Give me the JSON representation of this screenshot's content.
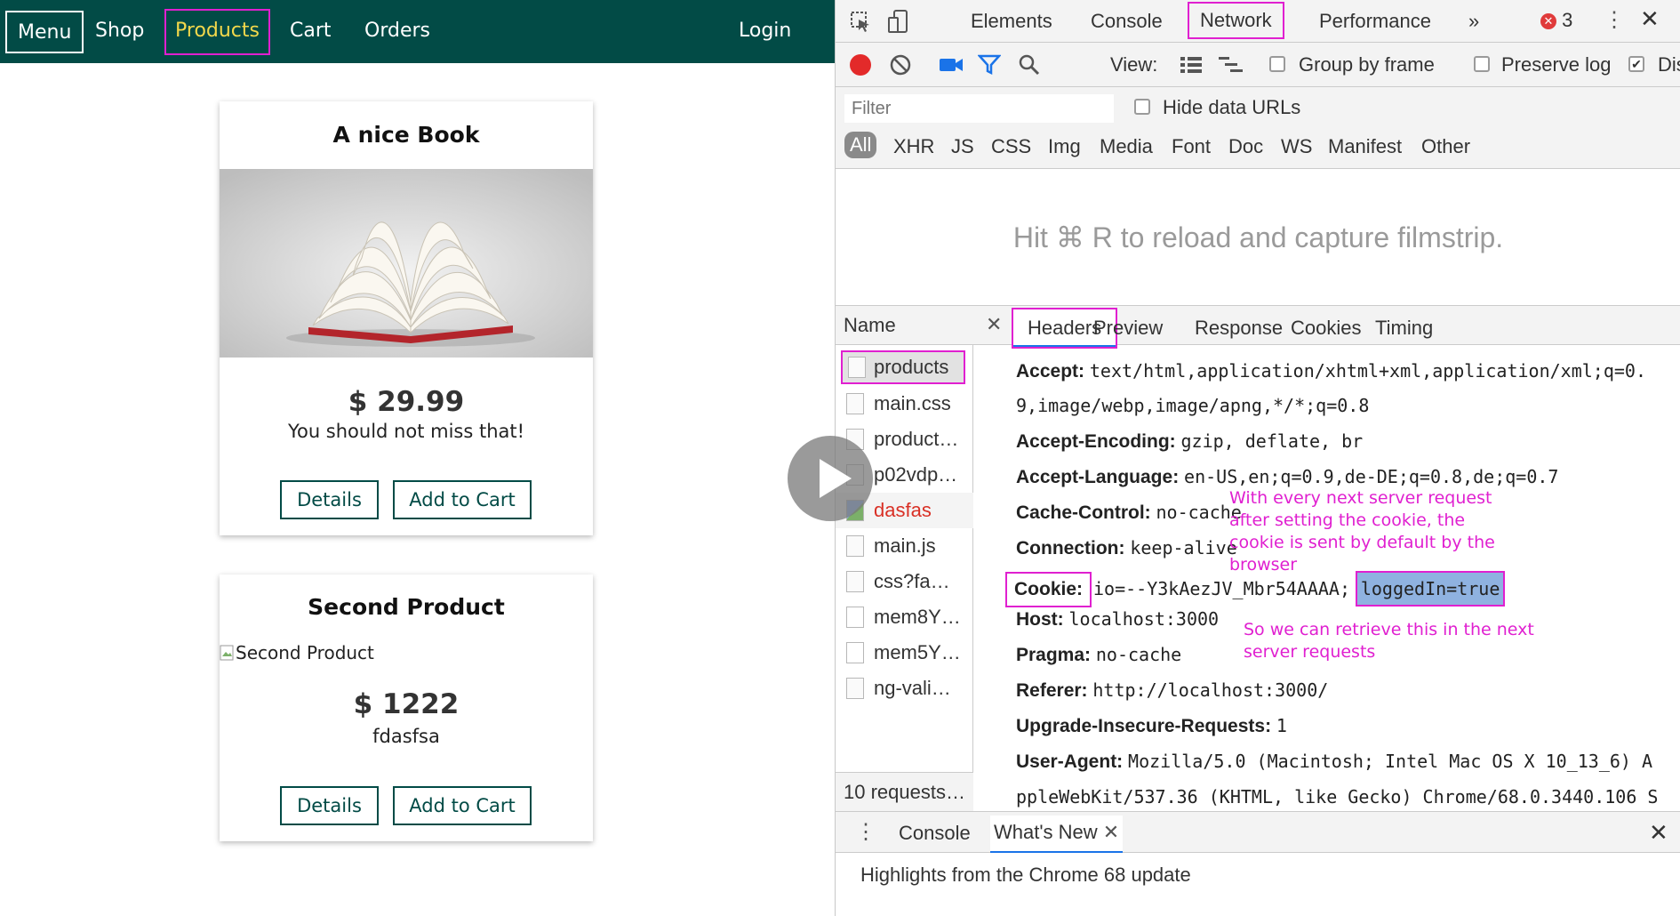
{
  "nav": {
    "menu": "Menu",
    "shop": "Shop",
    "products": "Products",
    "cart": "Cart",
    "orders": "Orders",
    "login": "Login"
  },
  "products": [
    {
      "title": "A nice Book",
      "price": "$ 29.99",
      "description": "You should not miss that!",
      "details_label": "Details",
      "add_label": "Add to Cart"
    },
    {
      "title": "Second Product",
      "image_alt": "Second Product",
      "price": "$ 1222",
      "description": "fdasfsa",
      "details_label": "Details",
      "add_label": "Add to Cart"
    }
  ],
  "devtools": {
    "tabs": [
      "Elements",
      "Console",
      "Network",
      "Performance",
      "»"
    ],
    "error_count": "3",
    "toolbar": {
      "view_label": "View:",
      "group_by_frame": "Group by frame",
      "preserve_log": "Preserve log",
      "disable_cache": "Dis"
    },
    "filter_placeholder": "Filter",
    "hide_data_urls": "Hide data URLs",
    "types": [
      "All",
      "XHR",
      "JS",
      "CSS",
      "Img",
      "Media",
      "Font",
      "Doc",
      "WS",
      "Manifest",
      "Other"
    ],
    "filmstrip_hint": "Hit ⌘ R to reload and capture filmstrip.",
    "name_header": "Name",
    "requests": [
      "products",
      "main.css",
      "product…",
      "p02vdp…",
      "dasfas",
      "main.js",
      "css?fa…",
      "mem8Y…",
      "mem5Y…",
      "ng-vali…"
    ],
    "request_count": "10 requests…",
    "detail_tabs": [
      "Headers",
      "Preview",
      "Response",
      "Cookies",
      "Timing"
    ],
    "headers": [
      {
        "key": "Accept:",
        "value": "text/html,application/xhtml+xml,application/xml;q=0."
      },
      {
        "key": "",
        "value": "9,image/webp,image/apng,*/*;q=0.8"
      },
      {
        "key": "Accept-Encoding:",
        "value": "gzip, deflate, br"
      },
      {
        "key": "Accept-Language:",
        "value": "en-US,en;q=0.9,de-DE;q=0.8,de;q=0.7"
      },
      {
        "key": "Cache-Control:",
        "value": "no-cache"
      },
      {
        "key": "Connection:",
        "value": "keep-alive"
      },
      {
        "key": "Cookie:",
        "value": "io=--Y3kAezJV_Mbr54AAAA;"
      },
      {
        "key": "Host:",
        "value": "localhost:3000"
      },
      {
        "key": "Pragma:",
        "value": "no-cache"
      },
      {
        "key": "Referer:",
        "value": "http://localhost:3000/"
      },
      {
        "key": "Upgrade-Insecure-Requests:",
        "value": "1"
      },
      {
        "key": "User-Agent:",
        "value": "Mozilla/5.0 (Macintosh; Intel Mac OS X 10_13_6) A"
      },
      {
        "key": "",
        "value": "ppleWebKit/537.36 (KHTML, like Gecko) Chrome/68.0.3440.106 S"
      }
    ],
    "cookie_highlight": "loggedIn=true",
    "drawer_tabs": [
      "Console",
      "What's New"
    ],
    "drawer_text": "Highlights from the Chrome 68 update"
  },
  "annotations": {
    "note1": [
      "With every next server request",
      "after setting the cookie,  the",
      "cookie is sent by default by the",
      "browser"
    ],
    "note2": [
      "So we can retrieve this in the next",
      "server requests"
    ]
  },
  "colors": {
    "nav_bg": "#024b46",
    "active_nav": "#f2d84b",
    "annotation": "#e020d0",
    "highlight": "#8fb2e0"
  }
}
